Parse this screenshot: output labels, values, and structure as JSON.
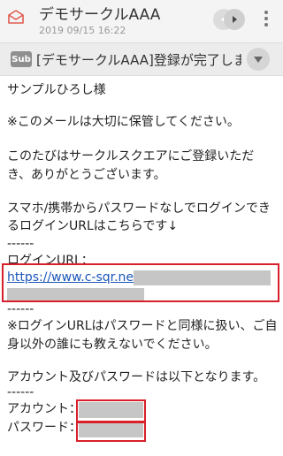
{
  "header": {
    "title": "デモサークルAAA",
    "date": "2019 09/15 16:22"
  },
  "subject": {
    "badge": "Sub",
    "text": "[デモサークルAAA]登録が完了しました"
  },
  "body": {
    "greeting": "サンプルひろし様",
    "notice": "※このメールは大切に保管してください。",
    "thanks_1": "このたびはサークルスクエアにご登録いただ",
    "thanks_2": "き、ありがとうございます。",
    "login_intro_1": "スマホ/携帯からパスワードなしでログインでき",
    "login_intro_2": "るログインURLはこちらです↓",
    "separator": "------",
    "login_url_label": "ログインURL：",
    "login_url_visible": "https://www.c-sqr.net/",
    "warning_1": "※ログインURLはパスワードと同様に扱い、ご自",
    "warning_2": "身以外の誰にも教えないでください。",
    "account_intro": "アカウント及びパスワードは以下となります。",
    "account_label": "アカウント：",
    "password_label": "パスワード："
  },
  "colors": {
    "highlight_box": "#d8202a",
    "link": "#1a56b8",
    "redaction": "#c6c6c6"
  },
  "icons": [
    "mail-open-icon",
    "chevron-left-icon",
    "chevron-right-icon",
    "more-vert-icon",
    "chevron-down-icon"
  ]
}
